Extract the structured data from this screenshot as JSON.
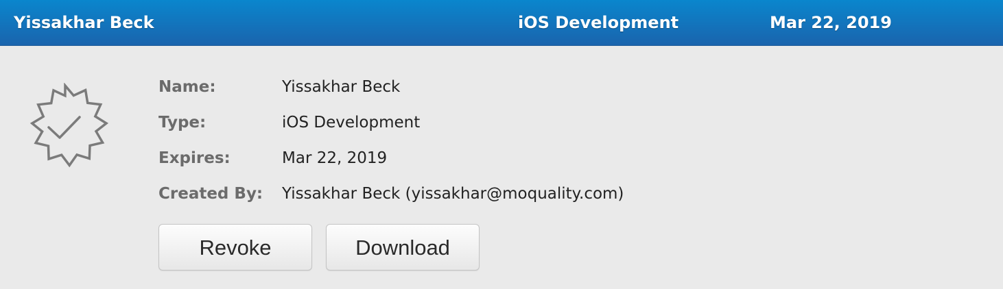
{
  "header": {
    "name": "Yissakhar Beck",
    "type": "iOS Development",
    "expires": "Mar 22, 2019"
  },
  "details": {
    "name_label": "Name:",
    "name_value": "Yissakhar Beck",
    "type_label": "Type:",
    "type_value": "iOS Development",
    "expires_label": "Expires:",
    "expires_value": "Mar 22, 2019",
    "created_label": "Created By:",
    "created_value": "Yissakhar Beck (yissakhar@moquality.com)"
  },
  "actions": {
    "revoke_label": "Revoke",
    "download_label": "Download"
  },
  "icons": {
    "certificate": "certificate-badge-icon"
  },
  "colors": {
    "header_top": "#0a86cd",
    "header_bottom": "#1a64ad",
    "panel_bg": "#eaeaea",
    "label_text": "#6b6b6b",
    "value_text": "#222222"
  }
}
